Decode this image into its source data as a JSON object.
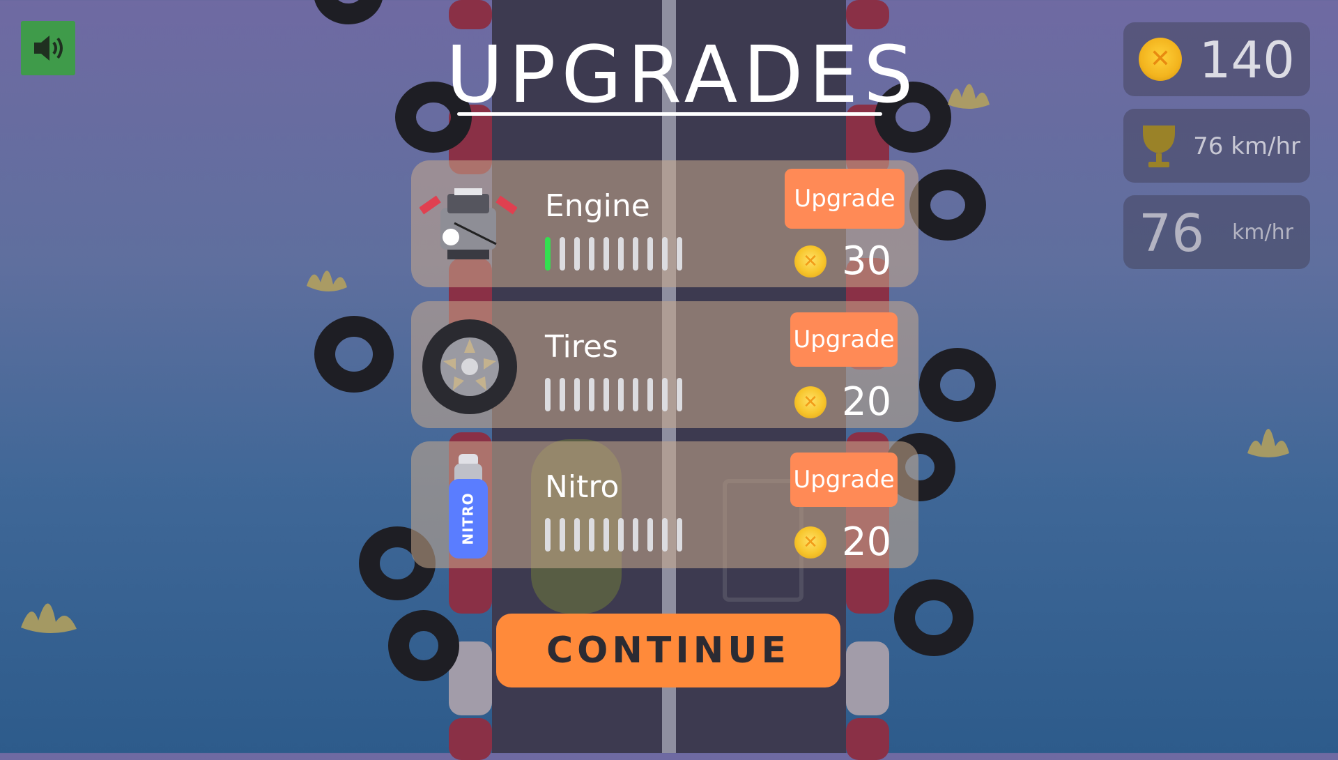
{
  "title": "UPGRADES",
  "upgrades": [
    {
      "label": "Engine",
      "button": "Upgrade",
      "cost": "30",
      "level": 1,
      "max_level": 10
    },
    {
      "label": "Tires",
      "button": "Upgrade",
      "cost": "20",
      "level": 0,
      "max_level": 10
    },
    {
      "label": "Nitro",
      "button": "Upgrade",
      "cost": "20",
      "level": 0,
      "max_level": 10,
      "bottle_text": "NITRO"
    }
  ],
  "continue_label": "CONTINUE",
  "hud": {
    "coins": "140",
    "best_speed": "76 km/hr",
    "current_speed": "76",
    "current_speed_unit": "km/hr"
  },
  "icons": [
    "speaker-icon",
    "engine-icon",
    "tire-icon",
    "nitro-bottle-icon",
    "coin-icon",
    "trophy-icon"
  ],
  "colors": {
    "upgrade_button": "#ff8a56",
    "continue_button": "#ff8a3a",
    "level_on": "#32e050",
    "sound_button": "#3f9b4a"
  }
}
